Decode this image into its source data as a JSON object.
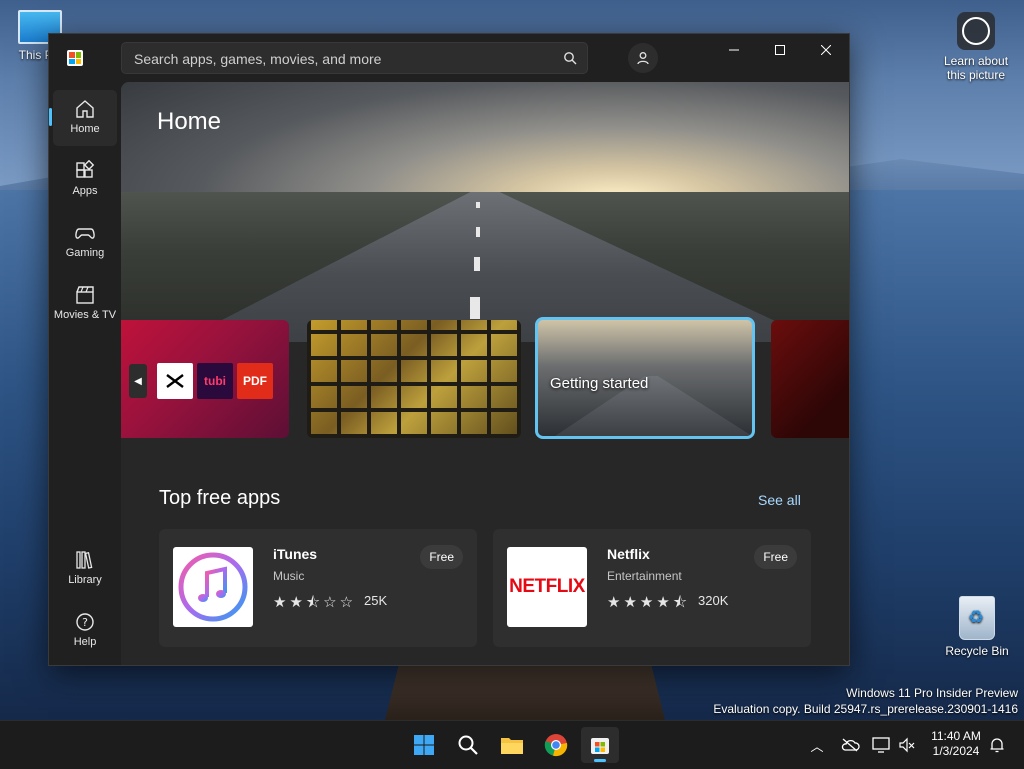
{
  "desktop": {
    "this_pc_label": "This PC",
    "learn_label": "Learn about this picture",
    "recycle_bin_label": "Recycle Bin",
    "watermark_line1": "Windows 11 Pro Insider Preview",
    "watermark_line2": "Evaluation copy. Build 25947.rs_prerelease.230901-1416"
  },
  "store": {
    "search_placeholder": "Search apps, games, movies, and more",
    "nav": [
      {
        "label": "Home",
        "icon": "home-icon"
      },
      {
        "label": "Apps",
        "icon": "apps-icon"
      },
      {
        "label": "Gaming",
        "icon": "gamepad-icon"
      },
      {
        "label": "Movies & TV",
        "icon": "clapperboard-icon"
      },
      {
        "label": "Library",
        "icon": "library-icon"
      },
      {
        "label": "Help",
        "icon": "help-icon"
      }
    ],
    "page_title": "Home",
    "carousel": {
      "card1_tiles": [
        "",
        "tubi",
        "PDF"
      ],
      "card3_label": "Getting started"
    },
    "section_title": "Top free apps",
    "see_all": "See all",
    "apps": [
      {
        "name": "iTunes",
        "category": "Music",
        "rating": 2.5,
        "rating_count": "25K",
        "price": "Free"
      },
      {
        "name": "Netflix",
        "category": "Entertainment",
        "rating": 4.5,
        "rating_count": "320K",
        "price": "Free",
        "logo_text": "NETFLIX"
      }
    ],
    "colors": {
      "accent": "#4cc2ff",
      "netflix_red": "#e50914",
      "highlight_border": "#63c4f1"
    }
  },
  "taskbar": {
    "time": "11:40 AM",
    "date": "1/3/2024"
  }
}
